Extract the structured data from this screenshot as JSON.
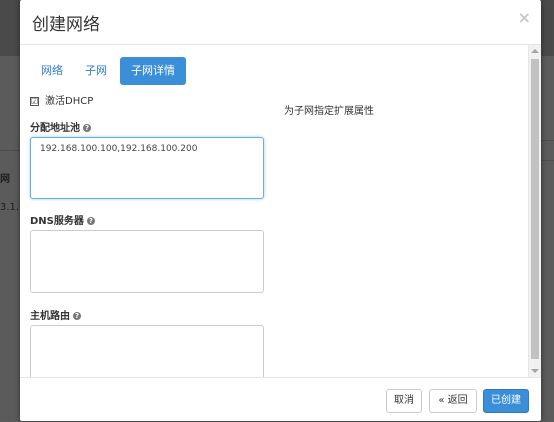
{
  "background": {
    "partial_col_header": "网",
    "partial_cell": "3.1.0/"
  },
  "modal": {
    "title": "创建网络",
    "close_symbol": "×"
  },
  "tabs": [
    {
      "label": "网络"
    },
    {
      "label": "子网"
    },
    {
      "label": "子网详情"
    }
  ],
  "form": {
    "dhcp_label": "激活DHCP",
    "dhcp_checked": true,
    "checkbox_mark": "☑",
    "help_glyph": "?",
    "pool_label": "分配地址池",
    "pool_value": "192.168.100.100,192.168.100.200",
    "dns_label": "DNS服务器",
    "dns_value": "",
    "routes_label": "主机路由",
    "routes_value": ""
  },
  "help_text": "为子网指定扩展属性",
  "footer": {
    "cancel_label": "取消",
    "back_label": "« 返回",
    "create_label": "已创建"
  },
  "colors": {
    "primary": "#3b8fd8",
    "link": "#2d7ad0"
  }
}
